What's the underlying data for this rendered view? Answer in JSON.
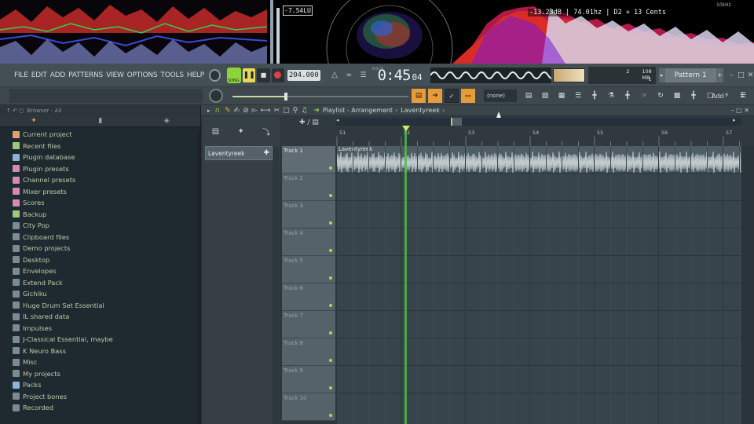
{
  "visualizer": {
    "loudness": "-7.54LU",
    "readout": "-13.23dB | 74.01hz | D2 + 13 Cents",
    "freq_label": "10kHz"
  },
  "menu": [
    "FILE",
    "EDIT",
    "ADD",
    "PATTERNS",
    "VIEW",
    "OPTIONS",
    "TOOLS",
    "HELP"
  ],
  "transport": {
    "song_label": "SONG",
    "bpm": "204.000",
    "time": "0:45",
    "time_sub": "04",
    "time_unit": "M:S:CS",
    "cpu": "2",
    "mem": "108 MB",
    "mem_sub": "1",
    "pattern": "Pattern 1"
  },
  "toolbar2": {
    "snap": "(none)",
    "add_label": "Add"
  },
  "browser": {
    "header": "Browser - All",
    "items": [
      {
        "label": "Current project",
        "icon": "project-icon",
        "color": "#e0a070"
      },
      {
        "label": "Recent files",
        "icon": "folder-icon",
        "color": "#9cc87a"
      },
      {
        "label": "Plugin database",
        "icon": "plug-icon",
        "color": "#8ab4d8"
      },
      {
        "label": "Plugin presets",
        "icon": "plug-icon",
        "color": "#d58ab0"
      },
      {
        "label": "Channel presets",
        "icon": "channel-icon",
        "color": "#d58ab0"
      },
      {
        "label": "Mixer presets",
        "icon": "mixer-icon",
        "color": "#d58ab0"
      },
      {
        "label": "Scores",
        "icon": "note-icon",
        "color": "#d58ab0"
      },
      {
        "label": "Backup",
        "icon": "folder-icon",
        "color": "#9cc87a"
      },
      {
        "label": "City Pop",
        "icon": "folder-icon",
        "color": "#7c8a92"
      },
      {
        "label": "Clipboard files",
        "icon": "folder-icon",
        "color": "#7c8a92"
      },
      {
        "label": "Demo projects",
        "icon": "folder-icon",
        "color": "#7c8a92"
      },
      {
        "label": "Desktop",
        "icon": "folder-icon",
        "color": "#7c8a92"
      },
      {
        "label": "Envelopes",
        "icon": "folder-icon",
        "color": "#7c8a92"
      },
      {
        "label": "Extend Pack",
        "icon": "folder-icon",
        "color": "#7c8a92"
      },
      {
        "label": "Gichiku",
        "icon": "folder-icon",
        "color": "#7c8a92"
      },
      {
        "label": "Huge Drum Set Essential",
        "icon": "folder-icon",
        "color": "#7c8a92"
      },
      {
        "label": "IL shared data",
        "icon": "folder-icon",
        "color": "#7c8a92"
      },
      {
        "label": "Impulses",
        "icon": "folder-icon",
        "color": "#7c8a92"
      },
      {
        "label": "J-Classical Essential, maybe",
        "icon": "folder-icon",
        "color": "#7c8a92"
      },
      {
        "label": "K Neuro Bass",
        "icon": "folder-icon",
        "color": "#7c8a92"
      },
      {
        "label": "Misc",
        "icon": "folder-icon",
        "color": "#7c8a92"
      },
      {
        "label": "My projects",
        "icon": "folder-icon",
        "color": "#7c8a92"
      },
      {
        "label": "Packs",
        "icon": "packs-icon",
        "color": "#8ab4d8"
      },
      {
        "label": "Project bones",
        "icon": "folder-icon",
        "color": "#7c8a92"
      },
      {
        "label": "Recorded",
        "icon": "folder-icon",
        "color": "#7c8a92"
      }
    ]
  },
  "playlist": {
    "title": "Playlist - Arrangement",
    "clip_name": "Laventyreek",
    "pattern_item": "Laventyreek",
    "ruler_marks": [
      "51",
      "52",
      "53",
      "54",
      "55",
      "56",
      "57"
    ],
    "tracks": [
      "Track 1",
      "Track 2",
      "Track 3",
      "Track 4",
      "Track 5",
      "Track 6",
      "Track 7",
      "Track 8",
      "Track 9",
      "Track 10"
    ]
  }
}
